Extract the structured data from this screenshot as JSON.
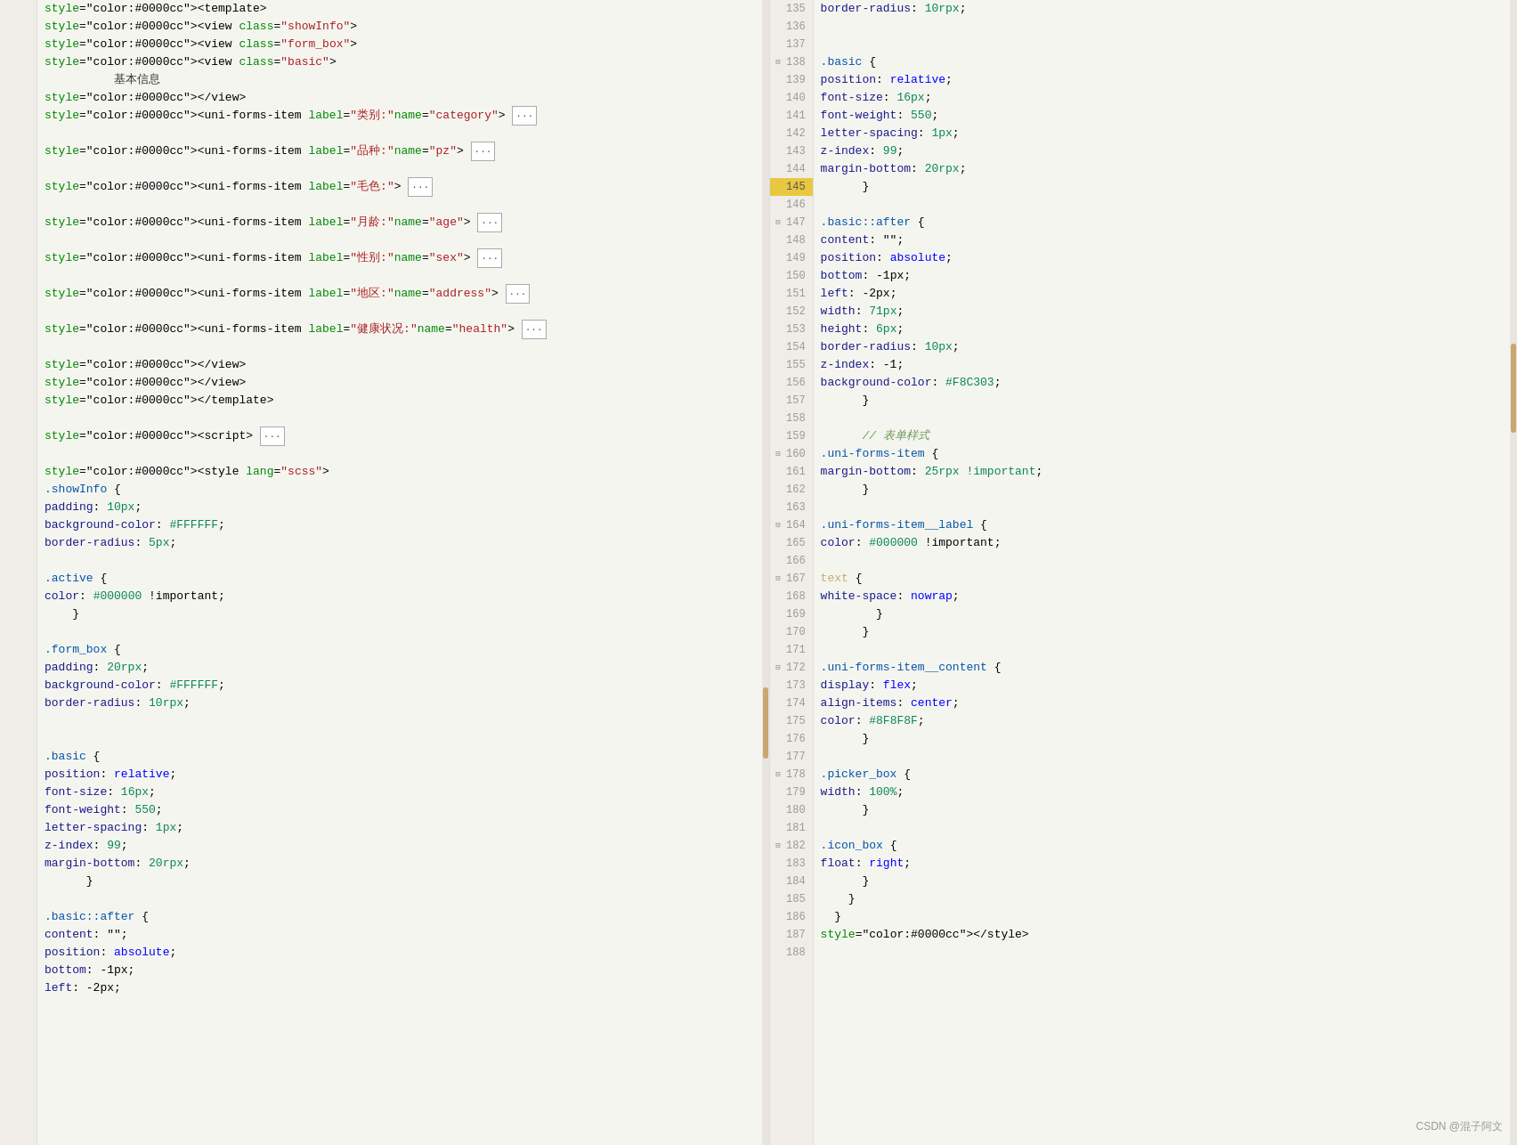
{
  "editor": {
    "left": {
      "lines": [
        {
          "num": null,
          "content": "<template>",
          "type": "tag"
        },
        {
          "num": null,
          "content": "  <view class=\"showInfo\">",
          "type": "tag"
        },
        {
          "num": null,
          "content": "    <view class=\"form_box\">",
          "type": "tag"
        },
        {
          "num": null,
          "content": "      <view class=\"basic\">",
          "type": "tag"
        },
        {
          "num": null,
          "content": "          基本信息",
          "type": "chinese"
        },
        {
          "num": null,
          "content": "      </view>",
          "type": "tag"
        },
        {
          "num": null,
          "content": "      <uni-forms-item label=\"类别:\" name=\"category\"> [···]",
          "type": "mixed"
        },
        {
          "num": null,
          "content": "",
          "type": "empty"
        },
        {
          "num": null,
          "content": "      <uni-forms-item label=\"品种:\" name=\"pz\"> [···]",
          "type": "mixed"
        },
        {
          "num": null,
          "content": "",
          "type": "empty"
        },
        {
          "num": null,
          "content": "      <uni-forms-item label=\"毛色:\"> [···]",
          "type": "mixed"
        },
        {
          "num": null,
          "content": "",
          "type": "empty"
        },
        {
          "num": null,
          "content": "      <uni-forms-item label=\"月龄:\" name=\"age\"> [···]",
          "type": "mixed"
        },
        {
          "num": null,
          "content": "",
          "type": "empty"
        },
        {
          "num": null,
          "content": "      <uni-forms-item label=\"性别:\" name=\"sex\"> [···]",
          "type": "mixed"
        },
        {
          "num": null,
          "content": "",
          "type": "empty"
        },
        {
          "num": null,
          "content": "      <uni-forms-item label=\"地区:\" name=\"address\"> [···]",
          "type": "mixed"
        },
        {
          "num": null,
          "content": "",
          "type": "empty"
        },
        {
          "num": null,
          "content": "      <uni-forms-item label=\"健康状况:\" name=\"health\"> [···]",
          "type": "mixed"
        },
        {
          "num": null,
          "content": "",
          "type": "empty"
        },
        {
          "num": null,
          "content": "    </view>",
          "type": "tag"
        },
        {
          "num": null,
          "content": "  </view>",
          "type": "tag"
        },
        {
          "num": null,
          "content": "</template>",
          "type": "tag"
        },
        {
          "num": null,
          "content": "",
          "type": "empty"
        },
        {
          "num": null,
          "content": "<script> [···]",
          "type": "script"
        },
        {
          "num": null,
          "content": "",
          "type": "empty"
        },
        {
          "num": null,
          "content": "<style lang=\"scss\">",
          "type": "tag"
        },
        {
          "num": null,
          "content": "  .showInfo {",
          "type": "selector"
        },
        {
          "num": null,
          "content": "    padding: 10px;",
          "type": "property"
        },
        {
          "num": null,
          "content": "    background-color: #FFFFFF;",
          "type": "property"
        },
        {
          "num": null,
          "content": "    border-radius: 5px;",
          "type": "property"
        },
        {
          "num": null,
          "content": "",
          "type": "empty"
        },
        {
          "num": null,
          "content": "    .active {",
          "type": "selector"
        },
        {
          "num": null,
          "content": "      color: #000000 !important;",
          "type": "property"
        },
        {
          "num": null,
          "content": "    }",
          "type": "brace"
        },
        {
          "num": null,
          "content": "",
          "type": "empty"
        },
        {
          "num": null,
          "content": "    .form_box {",
          "type": "selector"
        },
        {
          "num": null,
          "content": "      padding: 20rpx;",
          "type": "property"
        },
        {
          "num": null,
          "content": "      background-color: #FFFFFF;",
          "type": "property"
        },
        {
          "num": null,
          "content": "      border-radius: 10rpx;",
          "type": "property"
        },
        {
          "num": null,
          "content": "",
          "type": "empty"
        },
        {
          "num": null,
          "content": "",
          "type": "empty"
        },
        {
          "num": null,
          "content": "      .basic {",
          "type": "selector"
        },
        {
          "num": null,
          "content": "        position: relative;",
          "type": "property"
        },
        {
          "num": null,
          "content": "        font-size: 16px;",
          "type": "property"
        },
        {
          "num": null,
          "content": "        font-weight: 550;",
          "type": "property"
        },
        {
          "num": null,
          "content": "        letter-spacing: 1px;",
          "type": "property"
        },
        {
          "num": null,
          "content": "        z-index: 99;",
          "type": "property"
        },
        {
          "num": null,
          "content": "        margin-bottom: 20rpx;",
          "type": "property"
        },
        {
          "num": null,
          "content": "      }",
          "type": "brace"
        },
        {
          "num": null,
          "content": "",
          "type": "empty"
        },
        {
          "num": null,
          "content": "      .basic::after {",
          "type": "selector"
        },
        {
          "num": null,
          "content": "        content: \"\";",
          "type": "property"
        },
        {
          "num": null,
          "content": "        position: absolute;",
          "type": "property"
        },
        {
          "num": null,
          "content": "        bottom: -1px;",
          "type": "property"
        },
        {
          "num": null,
          "content": "        left: -2px;",
          "type": "property"
        }
      ]
    },
    "right": {
      "lines": [
        {
          "num": "135",
          "fold": false,
          "content": "    border-radius: 10rpx;",
          "type": "property"
        },
        {
          "num": "136",
          "fold": false,
          "content": "",
          "type": "empty"
        },
        {
          "num": "137",
          "fold": false,
          "content": "",
          "type": "empty"
        },
        {
          "num": "138",
          "fold": true,
          "content": "      .basic {",
          "type": "selector"
        },
        {
          "num": "139",
          "fold": false,
          "content": "        position: relative;",
          "type": "property"
        },
        {
          "num": "140",
          "fold": false,
          "content": "        font-size: 16px;",
          "type": "property"
        },
        {
          "num": "141",
          "fold": false,
          "content": "        font-weight: 550;",
          "type": "property"
        },
        {
          "num": "142",
          "fold": false,
          "content": "        letter-spacing: 1px;",
          "type": "property"
        },
        {
          "num": "143",
          "fold": false,
          "content": "        z-index: 99;",
          "type": "property"
        },
        {
          "num": "144",
          "fold": false,
          "content": "        margin-bottom: 20rpx;",
          "type": "property"
        },
        {
          "num": "145",
          "fold": false,
          "content": "      }",
          "type": "brace",
          "highlight": true
        },
        {
          "num": "146",
          "fold": false,
          "content": "",
          "type": "empty"
        },
        {
          "num": "147",
          "fold": true,
          "content": "      .basic::after {",
          "type": "selector"
        },
        {
          "num": "148",
          "fold": false,
          "content": "        content: \"\";",
          "type": "property"
        },
        {
          "num": "149",
          "fold": false,
          "content": "        position: absolute;",
          "type": "property"
        },
        {
          "num": "150",
          "fold": false,
          "content": "        bottom: -1px;",
          "type": "property"
        },
        {
          "num": "151",
          "fold": false,
          "content": "        left: -2px;",
          "type": "property"
        },
        {
          "num": "152",
          "fold": false,
          "content": "        width: 71px;",
          "type": "property"
        },
        {
          "num": "153",
          "fold": false,
          "content": "        height: 6px;",
          "type": "property"
        },
        {
          "num": "154",
          "fold": false,
          "content": "        border-radius: 10px;",
          "type": "property"
        },
        {
          "num": "155",
          "fold": false,
          "content": "        z-index: -1;",
          "type": "property"
        },
        {
          "num": "156",
          "fold": false,
          "content": "        background-color: #F8C303;",
          "type": "property"
        },
        {
          "num": "157",
          "fold": false,
          "content": "      }",
          "type": "brace"
        },
        {
          "num": "158",
          "fold": false,
          "content": "",
          "type": "empty"
        },
        {
          "num": "159",
          "fold": false,
          "content": "      // 表单样式",
          "type": "comment"
        },
        {
          "num": "160",
          "fold": true,
          "content": "      .uni-forms-item {",
          "type": "selector"
        },
        {
          "num": "161",
          "fold": false,
          "content": "        margin-bottom: 25rpx !important;",
          "type": "property"
        },
        {
          "num": "162",
          "fold": false,
          "content": "      }",
          "type": "brace"
        },
        {
          "num": "163",
          "fold": false,
          "content": "",
          "type": "empty"
        },
        {
          "num": "164",
          "fold": true,
          "content": "      .uni-forms-item__label {",
          "type": "selector"
        },
        {
          "num": "165",
          "fold": false,
          "content": "        color: #000000 !important;",
          "type": "property"
        },
        {
          "num": "166",
          "fold": false,
          "content": "",
          "type": "empty"
        },
        {
          "num": "167",
          "fold": true,
          "content": "        text {",
          "type": "selector"
        },
        {
          "num": "168",
          "fold": false,
          "content": "          white-space: nowrap;",
          "type": "property"
        },
        {
          "num": "169",
          "fold": false,
          "content": "        }",
          "type": "brace"
        },
        {
          "num": "170",
          "fold": false,
          "content": "      }",
          "type": "brace"
        },
        {
          "num": "171",
          "fold": false,
          "content": "",
          "type": "empty"
        },
        {
          "num": "172",
          "fold": true,
          "content": "      .uni-forms-item__content {",
          "type": "selector"
        },
        {
          "num": "173",
          "fold": false,
          "content": "        display: flex;",
          "type": "property"
        },
        {
          "num": "174",
          "fold": false,
          "content": "        align-items: center;",
          "type": "property"
        },
        {
          "num": "175",
          "fold": false,
          "content": "        color: #8F8F8F;",
          "type": "property"
        },
        {
          "num": "176",
          "fold": false,
          "content": "      }",
          "type": "brace"
        },
        {
          "num": "177",
          "fold": false,
          "content": "",
          "type": "empty"
        },
        {
          "num": "178",
          "fold": true,
          "content": "      .picker_box {",
          "type": "selector"
        },
        {
          "num": "179",
          "fold": false,
          "content": "        width: 100%;",
          "type": "property"
        },
        {
          "num": "180",
          "fold": false,
          "content": "      }",
          "type": "brace"
        },
        {
          "num": "181",
          "fold": false,
          "content": "",
          "type": "empty"
        },
        {
          "num": "182",
          "fold": true,
          "content": "      .icon_box {",
          "type": "selector"
        },
        {
          "num": "183",
          "fold": false,
          "content": "        float: right;",
          "type": "property"
        },
        {
          "num": "184",
          "fold": false,
          "content": "      }",
          "type": "brace"
        },
        {
          "num": "185",
          "fold": false,
          "content": "    }",
          "type": "brace"
        },
        {
          "num": "186",
          "fold": false,
          "content": "  }",
          "type": "brace"
        },
        {
          "num": "187",
          "fold": false,
          "content": "</style>",
          "type": "tag"
        },
        {
          "num": "188",
          "fold": false,
          "content": "",
          "type": "empty"
        }
      ]
    }
  },
  "watermark": "CSDN @混子阿文",
  "colors": {
    "highlight_line_bg": "#e8c840",
    "tag_color": "#0000cc",
    "selector_color": "#0033aa",
    "property_color": "#1a1a1a",
    "value_color": "#098658",
    "comment_color": "#6a9955",
    "string_color": "#aa2222",
    "scrollbar_color": "#c8a870"
  }
}
